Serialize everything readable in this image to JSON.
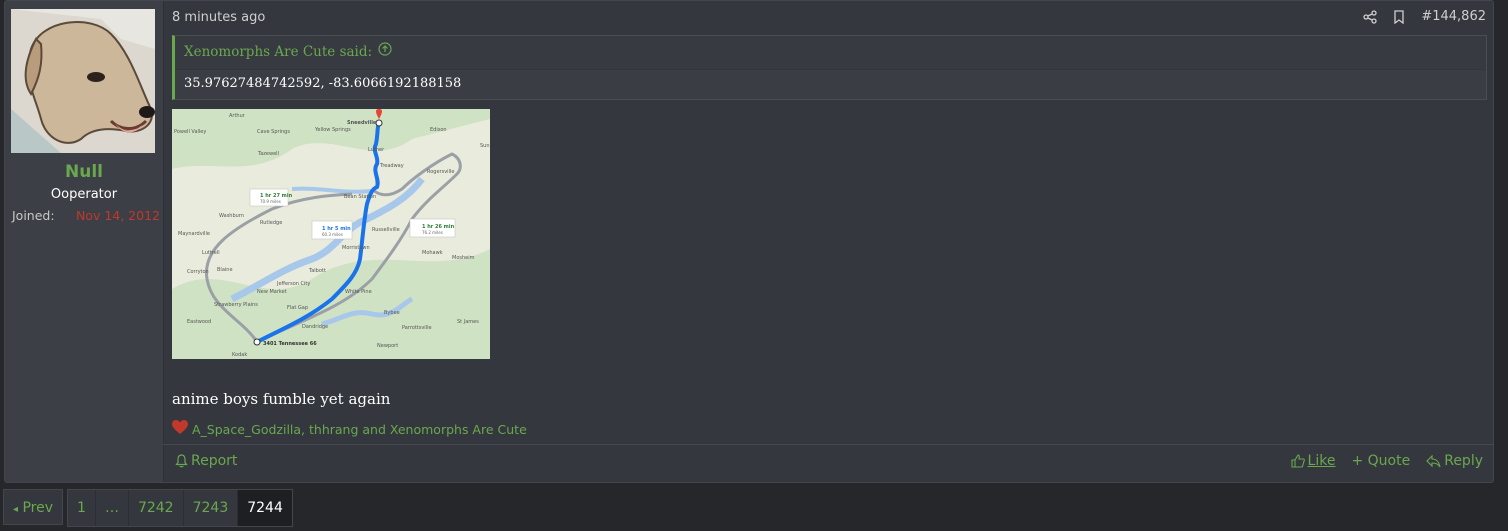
{
  "user": {
    "name": "Null",
    "title": "Ooperator",
    "joined_label": "Joined:",
    "joined_date": "Nov 14, 2012"
  },
  "post": {
    "time": "8 minutes ago",
    "number": "#144,862",
    "quote": {
      "author": "Xenomorphs Are Cute said:",
      "text": "35.97627484742592, -83.6066192188158"
    },
    "map": {
      "places": {
        "sneedville": "Sneedville",
        "arthur": "Arthur",
        "powell_valley": "Powell Valley",
        "cave_springs": "Cave Springs",
        "yellow_springs": "Yellow Springs",
        "edison": "Edison",
        "tazewell": "Tazewell",
        "luther": "Luther",
        "treadway": "Treadway",
        "sun": "Sun",
        "rogersville": "Rogersville",
        "bean_station": "Bean Station",
        "washburn": "Washburn",
        "rutledge": "Rutledge",
        "maynardville": "Maynardville",
        "russellville": "Russellville",
        "morristown": "Morristown",
        "luttrell": "Luttrell",
        "mohawk": "Mohawk",
        "mosheim": "Mosheim",
        "blaine": "Blaine",
        "corryton": "Corryton",
        "talbott": "Talbott",
        "jefferson_city": "Jefferson City",
        "new_market": "New Market",
        "white_pine": "White Pine",
        "strawberry_plains": "Strawberry Plains",
        "flat_gap": "Flat Gap",
        "eastwood": "Eastwood",
        "dandridge": "Dandridge",
        "bybee": "Bybee",
        "st_james": "St James",
        "parrottsville": "Parrottsville",
        "newport": "Newport",
        "kodak": "Kodak",
        "destination": "3401 Tennessee 66"
      },
      "routes": [
        {
          "time": "1 hr 27 min",
          "distance": "70.9 miles"
        },
        {
          "time": "1 hr 5 min",
          "distance": "60.3 miles"
        },
        {
          "time": "1 hr 26 min",
          "distance": "76.2 miles"
        }
      ]
    },
    "body": "anime boys fumble yet again",
    "reactions": "A_Space_Godzilla, thhrang and Xenomorphs Are Cute"
  },
  "actions": {
    "report": "Report",
    "like": "Like",
    "quote": "+ Quote",
    "reply": "Reply"
  },
  "pagination": {
    "prev": "Prev",
    "pages": [
      "1",
      "…",
      "7242",
      "7243",
      "7244"
    ],
    "current": "7244"
  },
  "colors": {
    "accent": "#6aa84f",
    "date": "#c0392b",
    "route_primary": "#1a73e8",
    "route_alt": "#9aa0a6"
  }
}
